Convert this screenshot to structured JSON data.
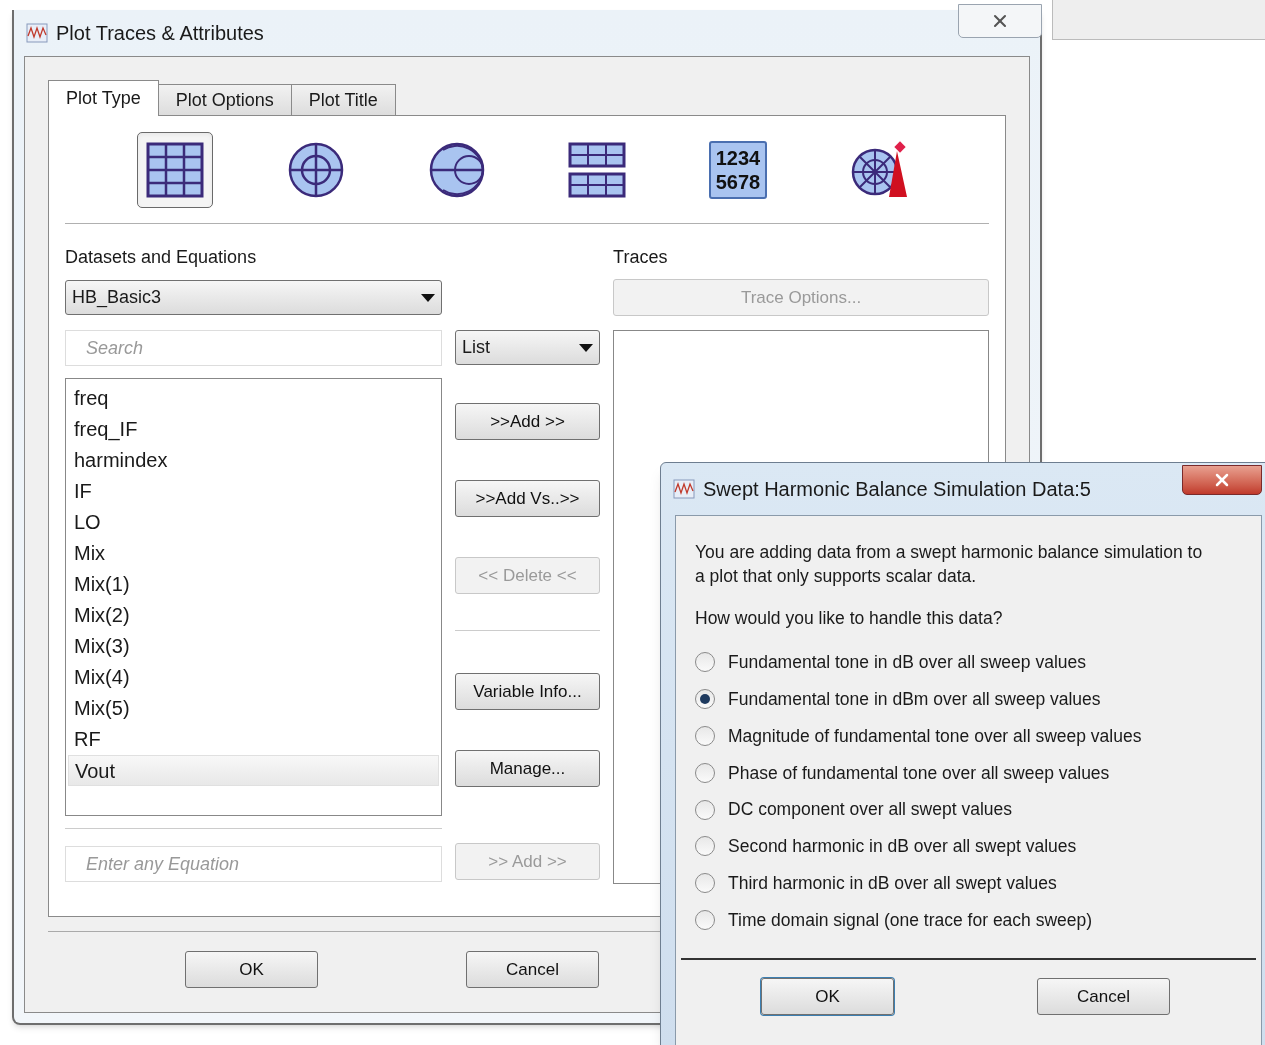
{
  "main_window": {
    "title": "Plot Traces & Attributes",
    "tabs": [
      {
        "label": "Plot Type",
        "selected": true
      },
      {
        "label": "Plot Options",
        "selected": false
      },
      {
        "label": "Plot Title",
        "selected": false
      }
    ],
    "plot_types": [
      {
        "kind": "rectangular",
        "selected": true
      },
      {
        "kind": "polar",
        "selected": false
      },
      {
        "kind": "smith",
        "selected": false
      },
      {
        "kind": "list",
        "selected": false
      },
      {
        "kind": "numeric",
        "selected": false,
        "icon_text": [
          "1234",
          "5678"
        ]
      },
      {
        "kind": "antenna",
        "selected": false
      }
    ],
    "datasets_label": "Datasets and Equations",
    "traces_label": "Traces",
    "dataset_select": {
      "value": "HB_Basic3"
    },
    "trace_options_button": {
      "label": "Trace Options...",
      "disabled": true
    },
    "search": {
      "placeholder": "Search"
    },
    "view_select": {
      "value": "List"
    },
    "variables": [
      {
        "label": "freq",
        "selected": false
      },
      {
        "label": "freq_IF",
        "selected": false
      },
      {
        "label": "harmindex",
        "selected": false
      },
      {
        "label": "IF",
        "selected": false
      },
      {
        "label": "LO",
        "selected": false
      },
      {
        "label": "Mix",
        "selected": false
      },
      {
        "label": "Mix(1)",
        "selected": false
      },
      {
        "label": "Mix(2)",
        "selected": false
      },
      {
        "label": "Mix(3)",
        "selected": false
      },
      {
        "label": "Mix(4)",
        "selected": false
      },
      {
        "label": "Mix(5)",
        "selected": false
      },
      {
        "label": "RF",
        "selected": false
      },
      {
        "label": "Vout",
        "selected": true
      }
    ],
    "middle_buttons": [
      {
        "label": ">>Add >>",
        "disabled": false
      },
      {
        "label": ">>Add Vs..>>",
        "disabled": false
      },
      {
        "label": "<< Delete <<",
        "disabled": true
      }
    ],
    "lower_buttons": [
      {
        "label": "Variable Info...",
        "disabled": false
      },
      {
        "label": "Manage...",
        "disabled": false
      }
    ],
    "equation": {
      "placeholder": "Enter any Equation"
    },
    "equation_add_button": {
      "label": ">> Add >>",
      "disabled": true
    },
    "footer_buttons": [
      "OK",
      "Cancel"
    ]
  },
  "dialog": {
    "title": "Swept Harmonic Balance Simulation Data:5",
    "message": "You are adding data from a swept harmonic balance simulation to a plot that only supports scalar data.",
    "question": "How would you like to handle this data?",
    "options": [
      {
        "label": "Fundamental tone in dB over all sweep values",
        "selected": false
      },
      {
        "label": "Fundamental tone in dBm over all sweep values",
        "selected": true
      },
      {
        "label": "Magnitude of fundamental tone over all sweep values",
        "selected": false
      },
      {
        "label": "Phase of fundamental tone over all sweep values",
        "selected": false
      },
      {
        "label": "DC component over all swept values",
        "selected": false
      },
      {
        "label": "Second harmonic in dB over all swept values",
        "selected": false
      },
      {
        "label": "Third harmonic in dB over all swept values",
        "selected": false
      },
      {
        "label": "Time domain signal (one trace for each sweep)",
        "selected": false
      }
    ],
    "buttons": [
      {
        "label": "OK",
        "default": true
      },
      {
        "label": "Cancel",
        "default": false
      }
    ]
  }
}
